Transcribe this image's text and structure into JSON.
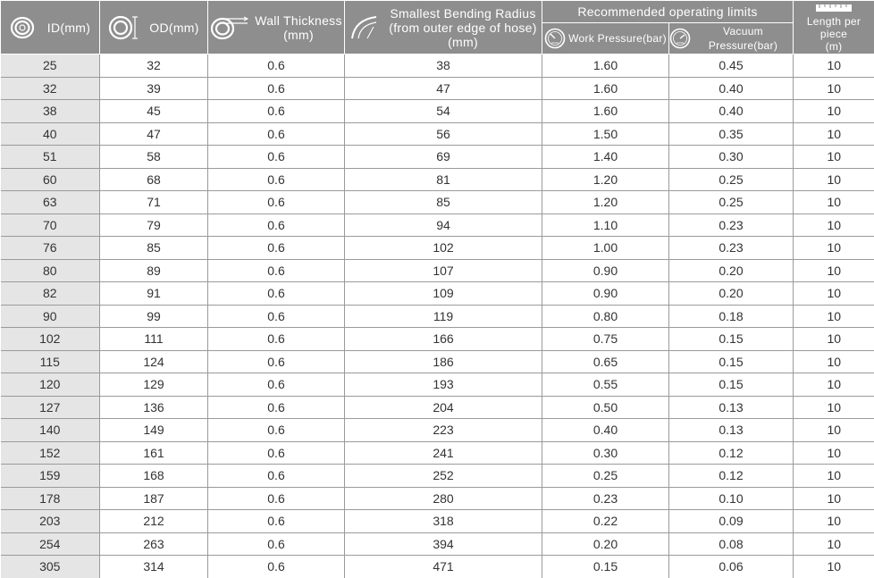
{
  "headers": {
    "id": "ID(mm)",
    "od": "OD(mm)",
    "wall": "Wall Thickness\n(mm)",
    "radius": "Smallest Bending Radius\n(from outer edge of hose)\n(mm)",
    "limits": "Recommended operating limits",
    "work": "Work Pressure(bar)",
    "vacuum": "Vacuum Pressure(bar)",
    "length": "Length per piece\n(m)"
  },
  "icons": {
    "id": "concentric-rings-icon",
    "od": "outer-diameter-rings-icon",
    "wall": "wall-thickness-rings-icon",
    "radius": "bend-radius-arc-icon",
    "work": "pressure-gauge-icon",
    "vacuum": "vacuum-gauge-icon",
    "length": "ruler-icon"
  },
  "colors": {
    "header_bg": "#8e8e8e",
    "header_text": "#ffffff",
    "first_col_bg": "#e5e5e5",
    "grid_line": "#9a9a9a"
  },
  "rows": [
    [
      "25",
      "32",
      "0.6",
      "38",
      "1.60",
      "0.45",
      "10"
    ],
    [
      "32",
      "39",
      "0.6",
      "47",
      "1.60",
      "0.40",
      "10"
    ],
    [
      "38",
      "45",
      "0.6",
      "54",
      "1.60",
      "0.40",
      "10"
    ],
    [
      "40",
      "47",
      "0.6",
      "56",
      "1.50",
      "0.35",
      "10"
    ],
    [
      "51",
      "58",
      "0.6",
      "69",
      "1.40",
      "0.30",
      "10"
    ],
    [
      "60",
      "68",
      "0.6",
      "81",
      "1.20",
      "0.25",
      "10"
    ],
    [
      "63",
      "71",
      "0.6",
      "85",
      "1.20",
      "0.25",
      "10"
    ],
    [
      "70",
      "79",
      "0.6",
      "94",
      "1.10",
      "0.23",
      "10"
    ],
    [
      "76",
      "85",
      "0.6",
      "102",
      "1.00",
      "0.23",
      "10"
    ],
    [
      "80",
      "89",
      "0.6",
      "107",
      "0.90",
      "0.20",
      "10"
    ],
    [
      "82",
      "91",
      "0.6",
      "109",
      "0.90",
      "0.20",
      "10"
    ],
    [
      "90",
      "99",
      "0.6",
      "119",
      "0.80",
      "0.18",
      "10"
    ],
    [
      "102",
      "111",
      "0.6",
      "166",
      "0.75",
      "0.15",
      "10"
    ],
    [
      "115",
      "124",
      "0.6",
      "186",
      "0.65",
      "0.15",
      "10"
    ],
    [
      "120",
      "129",
      "0.6",
      "193",
      "0.55",
      "0.15",
      "10"
    ],
    [
      "127",
      "136",
      "0.6",
      "204",
      "0.50",
      "0.13",
      "10"
    ],
    [
      "140",
      "149",
      "0.6",
      "223",
      "0.40",
      "0.13",
      "10"
    ],
    [
      "152",
      "161",
      "0.6",
      "241",
      "0.30",
      "0.12",
      "10"
    ],
    [
      "159",
      "168",
      "0.6",
      "252",
      "0.25",
      "0.12",
      "10"
    ],
    [
      "178",
      "187",
      "0.6",
      "280",
      "0.23",
      "0.10",
      "10"
    ],
    [
      "203",
      "212",
      "0.6",
      "318",
      "0.22",
      "0.09",
      "10"
    ],
    [
      "254",
      "263",
      "0.6",
      "394",
      "0.20",
      "0.08",
      "10"
    ],
    [
      "305",
      "314",
      "0.6",
      "471",
      "0.15",
      "0.06",
      "10"
    ]
  ]
}
